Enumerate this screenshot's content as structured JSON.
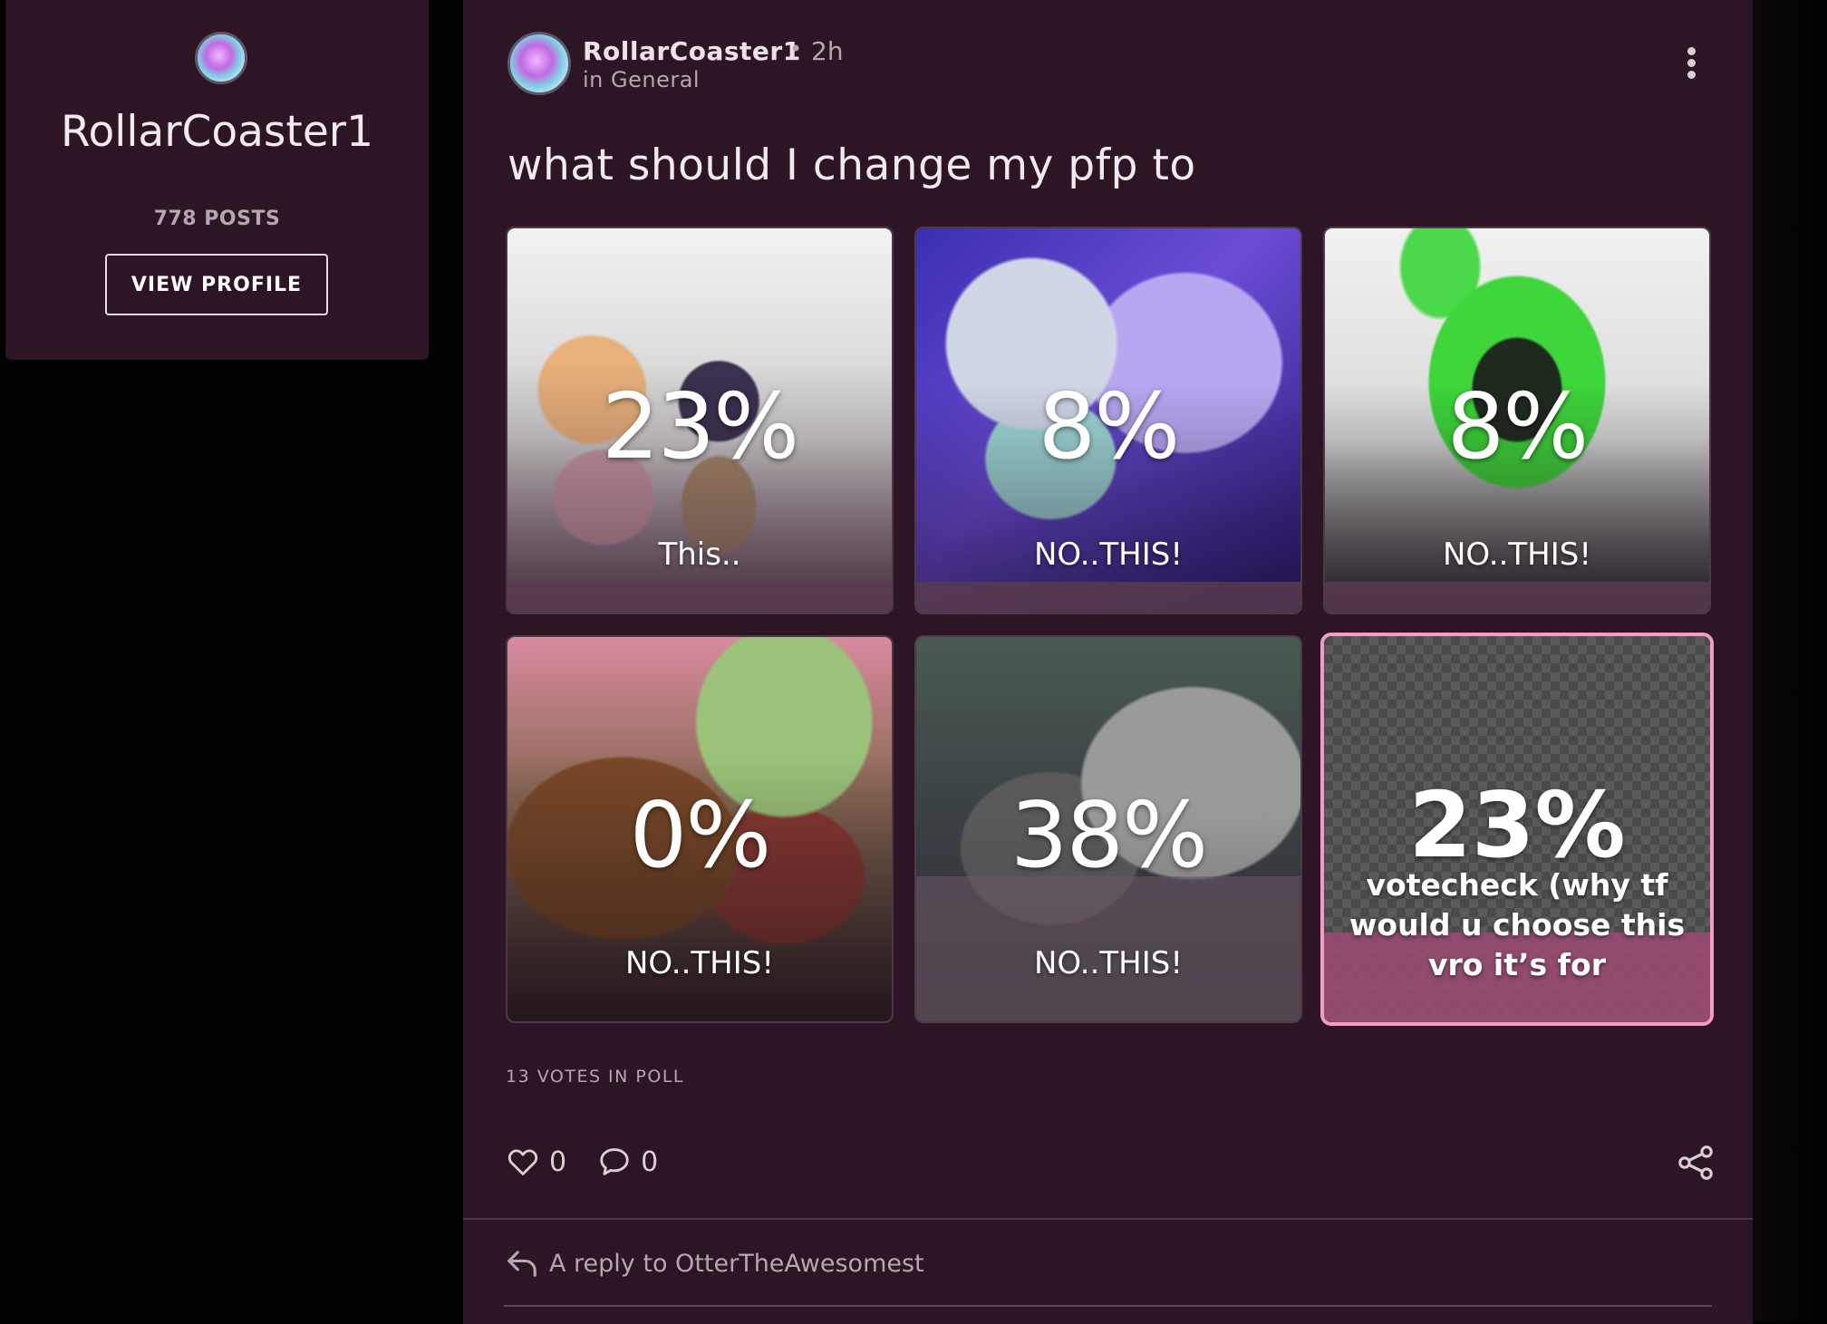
{
  "profile": {
    "username": "RollarCoaster1",
    "posts": "778 POSTS",
    "view_profile_label": "VIEW PROFILE"
  },
  "post": {
    "author": "RollarCoaster1",
    "separator": "•",
    "time": "2h",
    "community": "in General",
    "title": "what should I change my pfp to",
    "poll": {
      "options": [
        {
          "percent": "23%",
          "label": "This.."
        },
        {
          "percent": "8%",
          "label": "NO..THIS!"
        },
        {
          "percent": "8%",
          "label": "NO..THIS!"
        },
        {
          "percent": "0%",
          "label": "NO..THIS!"
        },
        {
          "percent": "38%",
          "label": "NO..THIS!"
        },
        {
          "percent": "23%",
          "label": "votecheck (why tf would u choose this vro it’s for",
          "selected": true
        }
      ],
      "votes_text": "13 VOTES IN POLL"
    },
    "likes": "0",
    "comments": "0"
  },
  "reply": {
    "text": "A reply to OtterTheAwesomest"
  },
  "colors": {
    "background": "#000000",
    "card": "#2e1525",
    "selected_border": "#f39bc4"
  },
  "icons": [
    "heart-icon",
    "comment-icon",
    "share-icon",
    "reply-icon",
    "more-options-icon"
  ]
}
